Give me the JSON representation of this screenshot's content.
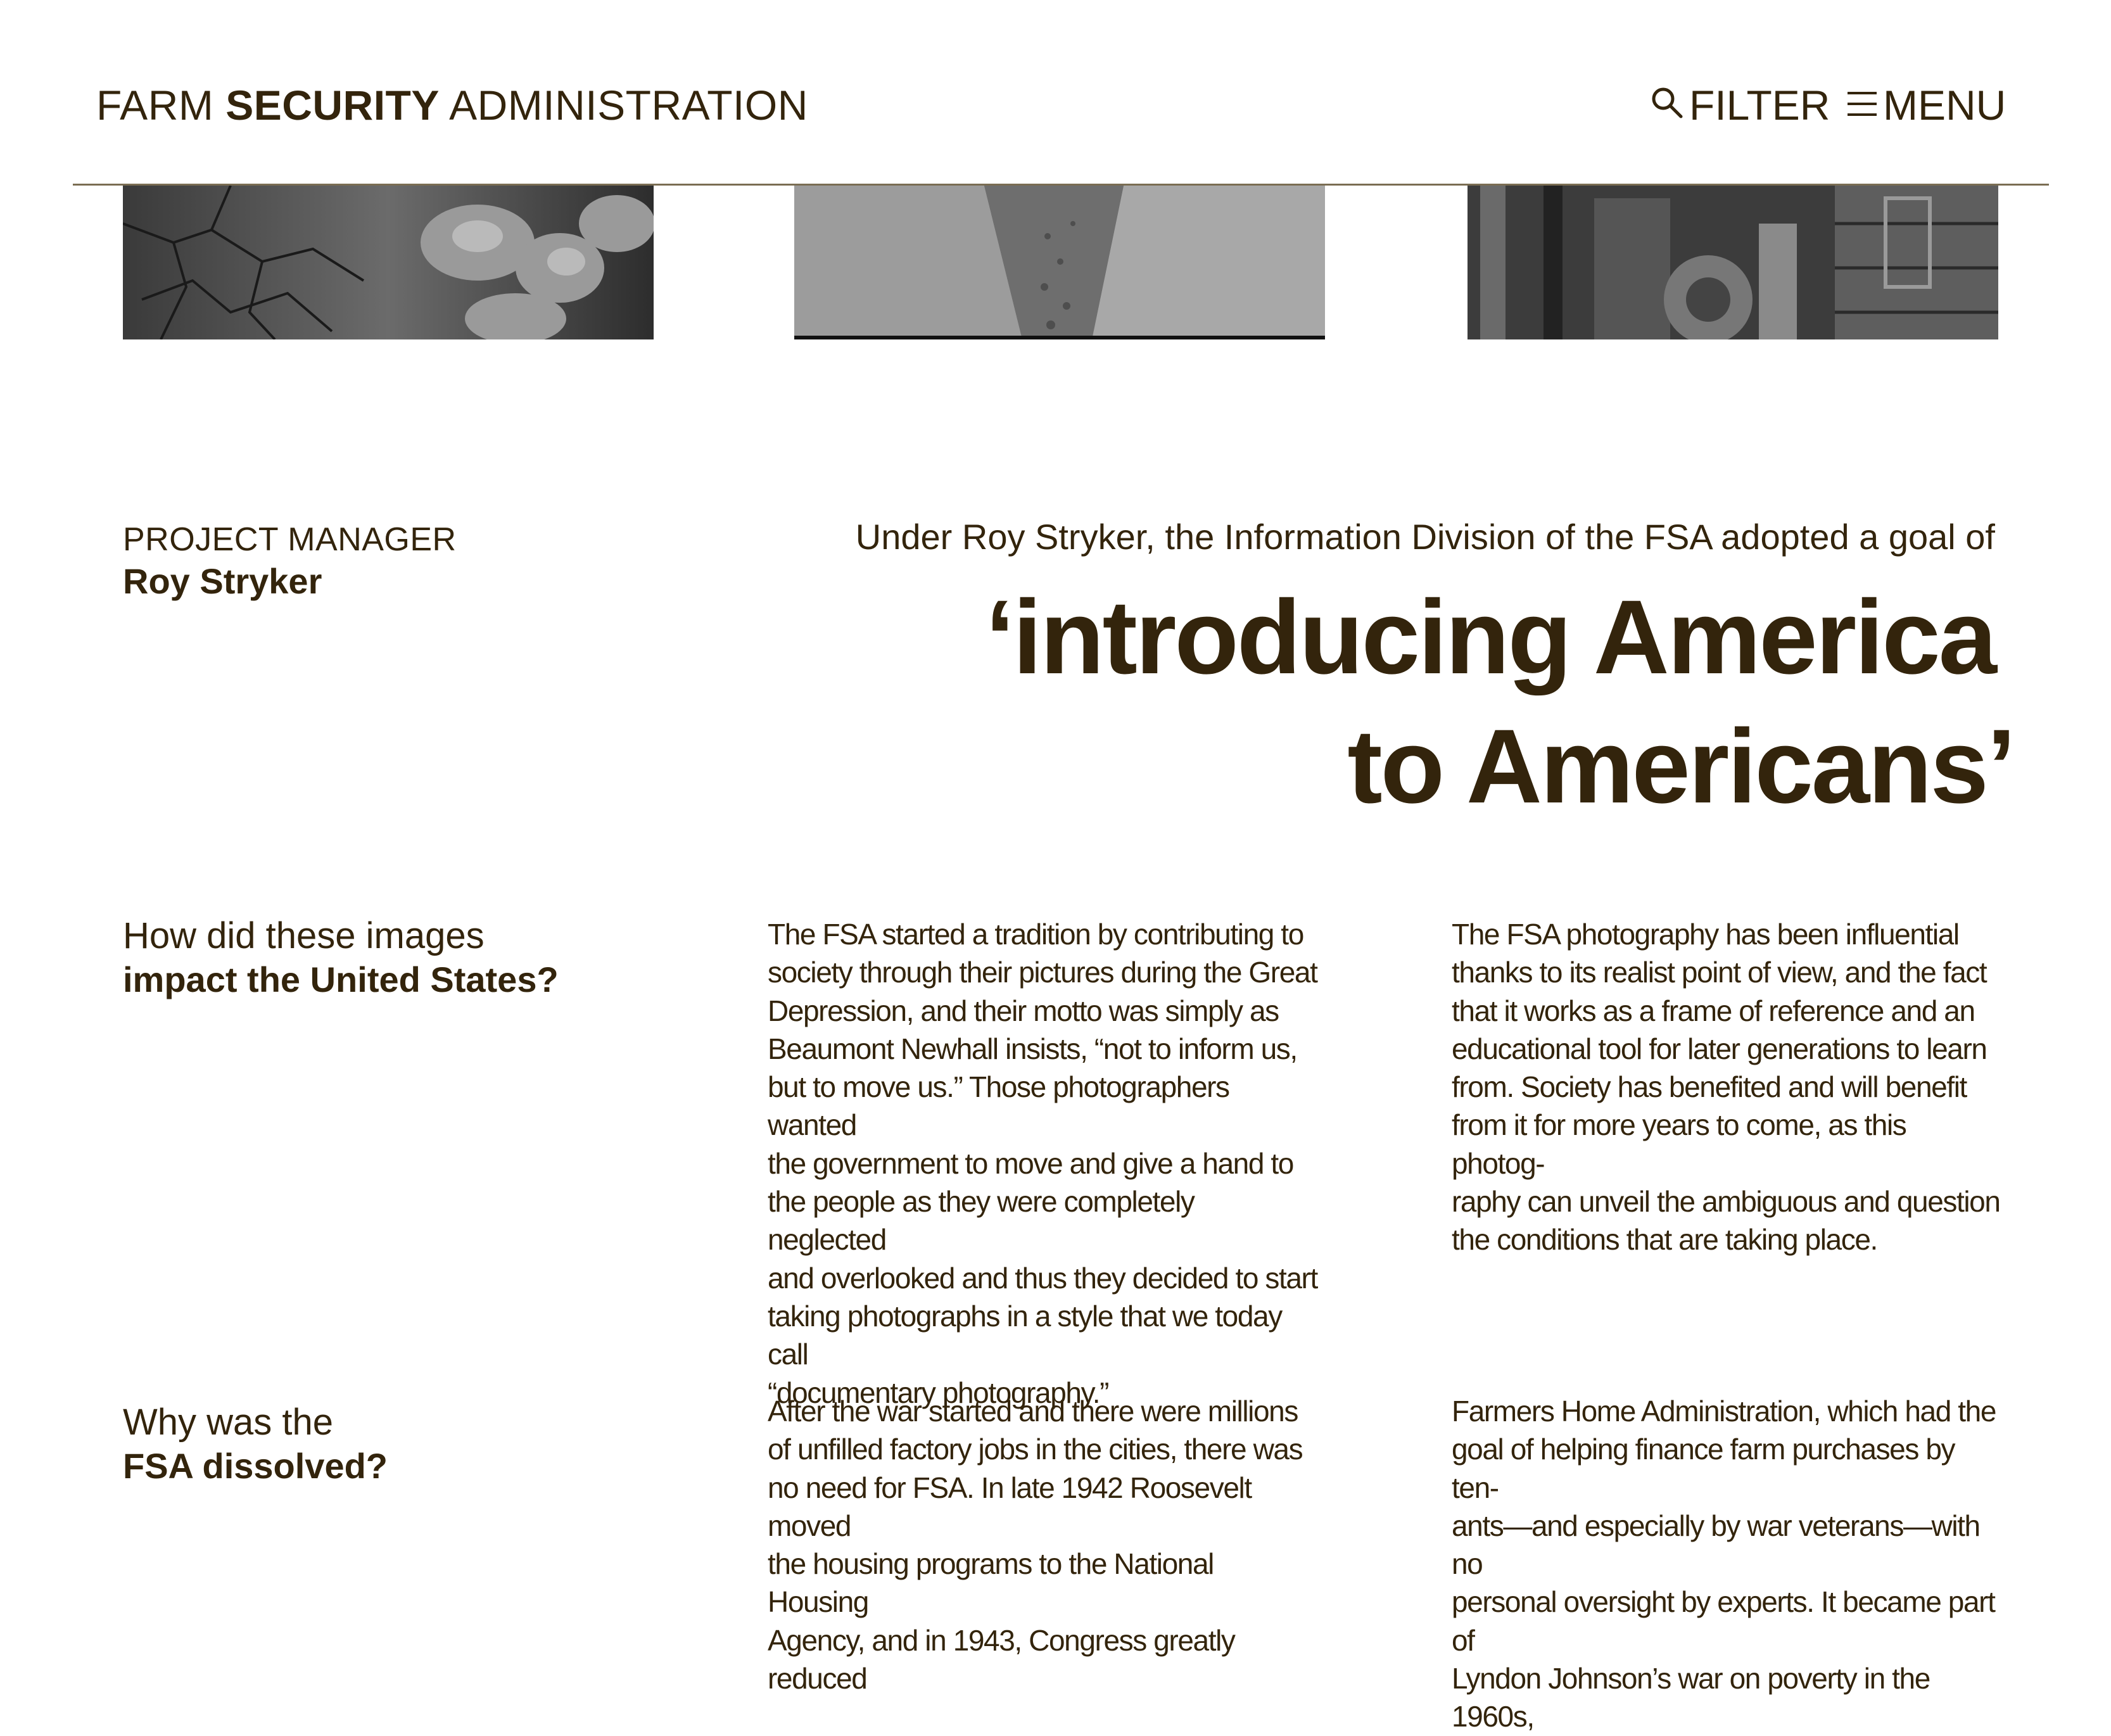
{
  "header": {
    "title_pre": "FARM ",
    "title_bold": "SECURITY",
    "title_post": " ADMINISTRATION",
    "filter_label": "FILTER",
    "menu_label": "MENU"
  },
  "project": {
    "label": "PROJECT MANAGER",
    "name": "Roy Stryker"
  },
  "quote": {
    "intro": "Under Roy Stryker, the Information Division of the FSA adopted a goal of",
    "line1": "‘introducing America",
    "line2": "to Americans’"
  },
  "sections": [
    {
      "question_light": "How did these images",
      "question_bold": "impact the United States?",
      "col1": "The FSA started a tradition by contributing to\nsociety through their pictures during the Great\nDepression, and their motto was simply as\nBeaumont Newhall insists, “not to inform us,\nbut to move us.” Those photographers wanted\nthe government to move and give a hand to\nthe people as they were completely neglected\nand overlooked and thus they decided to start\ntaking photographs in a style that we today call\n“documentary photography.”",
      "col2": "The FSA photography has been influential\nthanks to its realist point of view, and the fact\nthat it works as a frame of reference and an\neducational tool for later generations to learn\nfrom. Society has benefited and will benefit\nfrom it for more years to come, as this photog-\nraphy can unveil the ambiguous and question\nthe conditions that are taking place."
    },
    {
      "question_light": "Why was the",
      "question_bold": "FSA dissolved?",
      "col1": "After the war started and there were millions\nof unfilled factory jobs in the cities, there was\nno need for FSA. In late 1942 Roosevelt moved\nthe housing programs to the National Housing\nAgency, and in 1943, Congress greatly reduced",
      "col2": "Farmers Home Administration, which had the\ngoal of helping finance farm purchases by ten-\nants—and especially by war veterans—with no\npersonal oversight by experts. It became part of\nLyndon Johnson’s war on poverty in the 1960s,"
    }
  ],
  "icons": {
    "filter": "search-icon",
    "menu": "hamburger-icon"
  },
  "colors": {
    "text": "#33240c",
    "rule": "#7a6d53",
    "background": "#ffffff"
  }
}
